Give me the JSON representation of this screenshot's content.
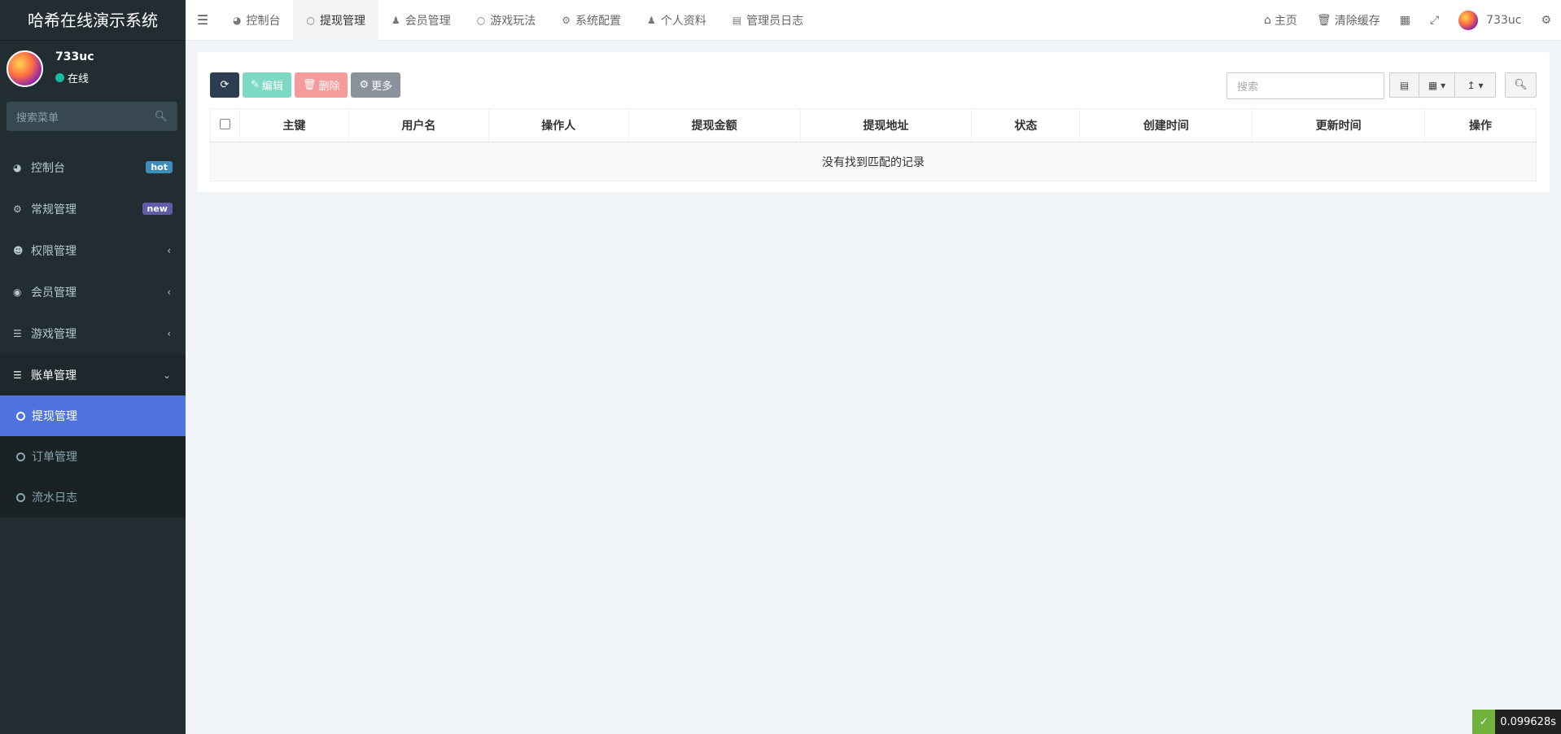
{
  "app_title": "哈希在线演示系统",
  "user": {
    "name": "733uc",
    "status": "在线"
  },
  "sidebar": {
    "search_placeholder": "搜索菜单",
    "items": [
      {
        "label": "控制台",
        "badge": "hot"
      },
      {
        "label": "常规管理",
        "badge": "new"
      },
      {
        "label": "权限管理"
      },
      {
        "label": "会员管理"
      },
      {
        "label": "游戏管理"
      },
      {
        "label": "账单管理"
      }
    ],
    "sub_items": [
      {
        "label": "提现管理"
      },
      {
        "label": "订单管理"
      },
      {
        "label": "流水日志"
      }
    ]
  },
  "tabs": [
    {
      "label": "控制台"
    },
    {
      "label": "提现管理"
    },
    {
      "label": "会员管理"
    },
    {
      "label": "游戏玩法"
    },
    {
      "label": "系统配置"
    },
    {
      "label": "个人资料"
    },
    {
      "label": "管理员日志"
    }
  ],
  "topbar_right": {
    "home": "主页",
    "clear_cache": "清除缓存",
    "username": "733uc"
  },
  "toolbar": {
    "edit": "编辑",
    "delete": "删除",
    "more": "更多"
  },
  "table": {
    "search_placeholder": "搜索",
    "columns": [
      "主键",
      "用户名",
      "操作人",
      "提现金额",
      "提现地址",
      "状态",
      "创建时间",
      "更新时间",
      "操作"
    ],
    "empty_text": "没有找到匹配的记录"
  },
  "timer": "0.099628s"
}
